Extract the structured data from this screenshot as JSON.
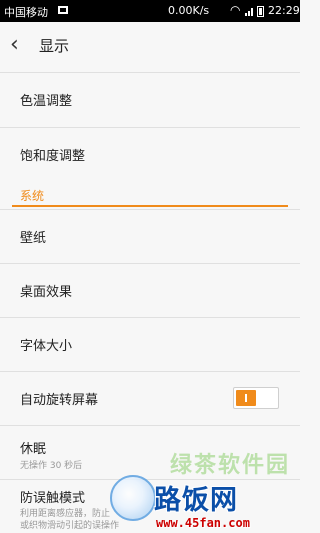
{
  "status_bar": {
    "carrier": "中国移动",
    "speed": "0.00K/s",
    "time": "22:29"
  },
  "header": {
    "title": "显示"
  },
  "items_top": [
    {
      "label": "色温调整"
    },
    {
      "label": "饱和度调整"
    }
  ],
  "section": {
    "label": "系统"
  },
  "items_system": [
    {
      "label": "壁纸"
    },
    {
      "label": "桌面效果"
    },
    {
      "label": "字体大小"
    },
    {
      "label": "自动旋转屏幕",
      "toggle": "on"
    },
    {
      "label": "休眠",
      "sub": "无操作 30 秒后"
    },
    {
      "label": "防误触模式",
      "sub": "利用距离感应器，防止",
      "sub2": "或织物滑动引起的误操作"
    }
  ],
  "watermark": {
    "faint": "绿茶软件园",
    "main": "路饭网",
    "url": "www.45fan.com"
  },
  "colors": {
    "accent": "#f08b1b",
    "background": "#f7f7f7"
  },
  "icons": {
    "back": "chevron-left-icon"
  }
}
